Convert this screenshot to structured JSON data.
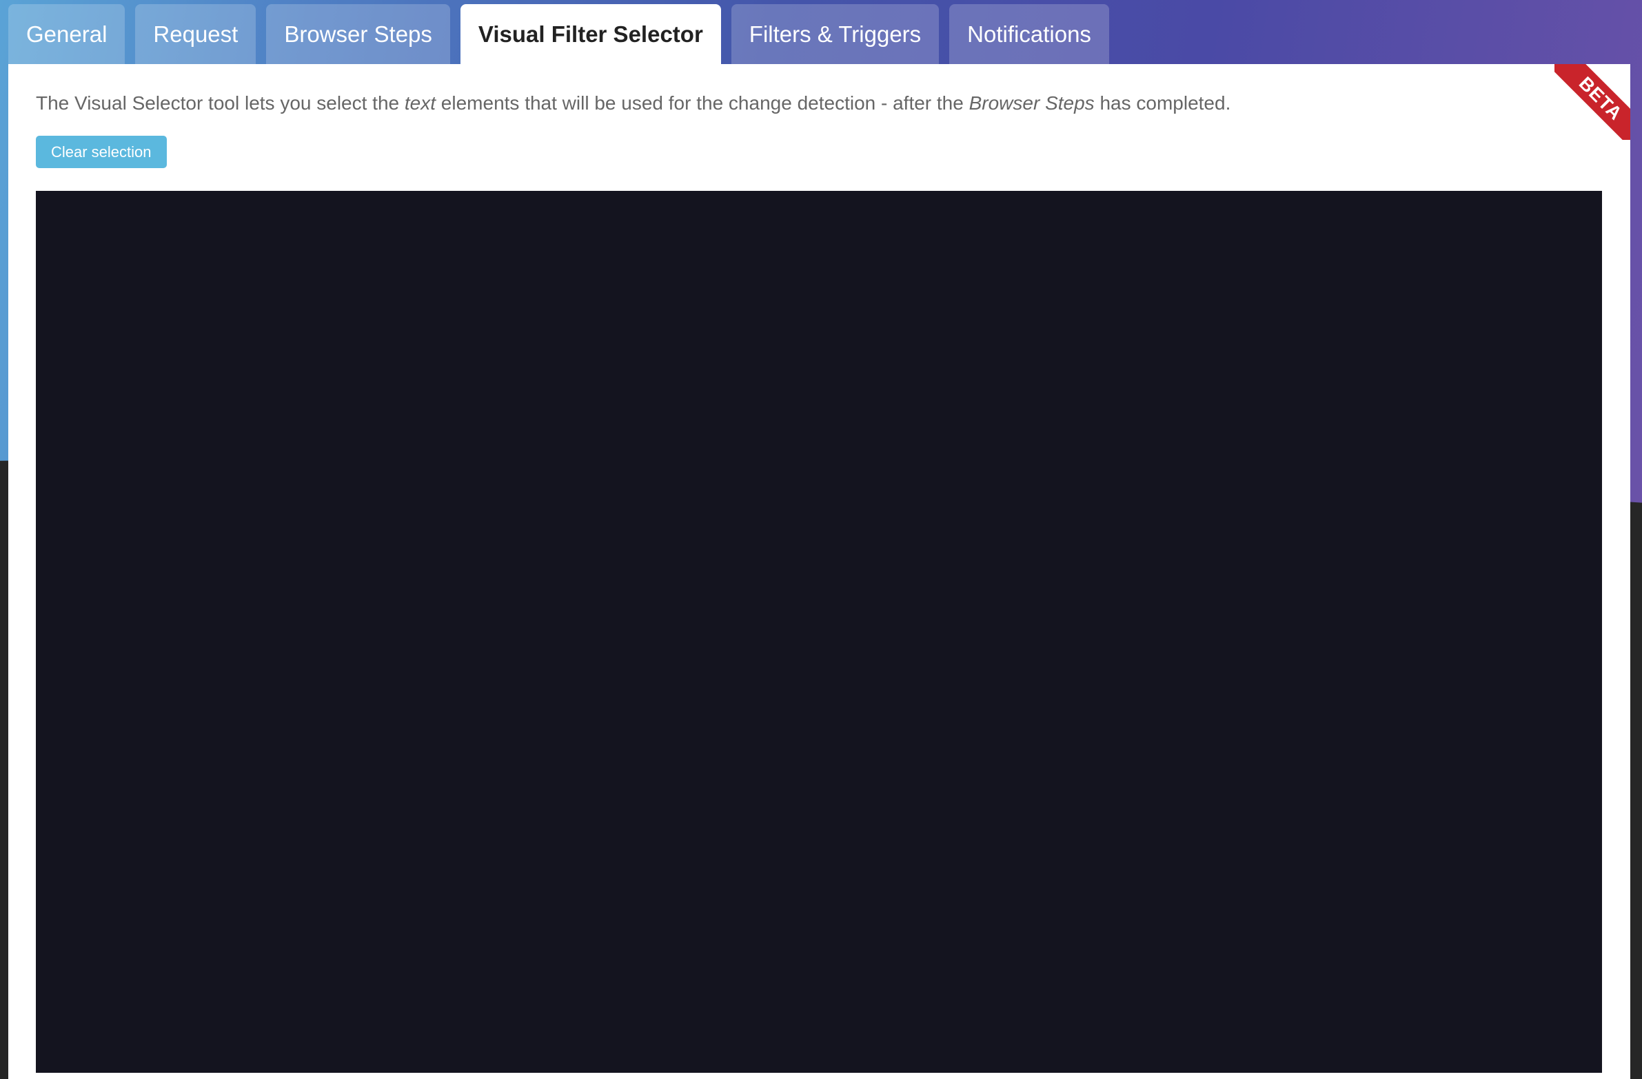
{
  "tabs": [
    {
      "label": "General",
      "active": false
    },
    {
      "label": "Request",
      "active": false
    },
    {
      "label": "Browser Steps",
      "active": false
    },
    {
      "label": "Visual Filter Selector",
      "active": true
    },
    {
      "label": "Filters & Triggers",
      "active": false
    },
    {
      "label": "Notifications",
      "active": false
    }
  ],
  "ribbon": {
    "label": "BETA",
    "color": "#c9242b"
  },
  "description": {
    "part1": "The Visual Selector tool lets you select the ",
    "em1": "text",
    "part2": " elements that will be used for the change detection - after the ",
    "em2": "Browser Steps",
    "part3": " has completed."
  },
  "clear_button": {
    "label": "Clear selection",
    "color": "#5bb8de"
  },
  "colors": {
    "canvas_bg": "#14141f",
    "active_tab_text": "#222222"
  }
}
